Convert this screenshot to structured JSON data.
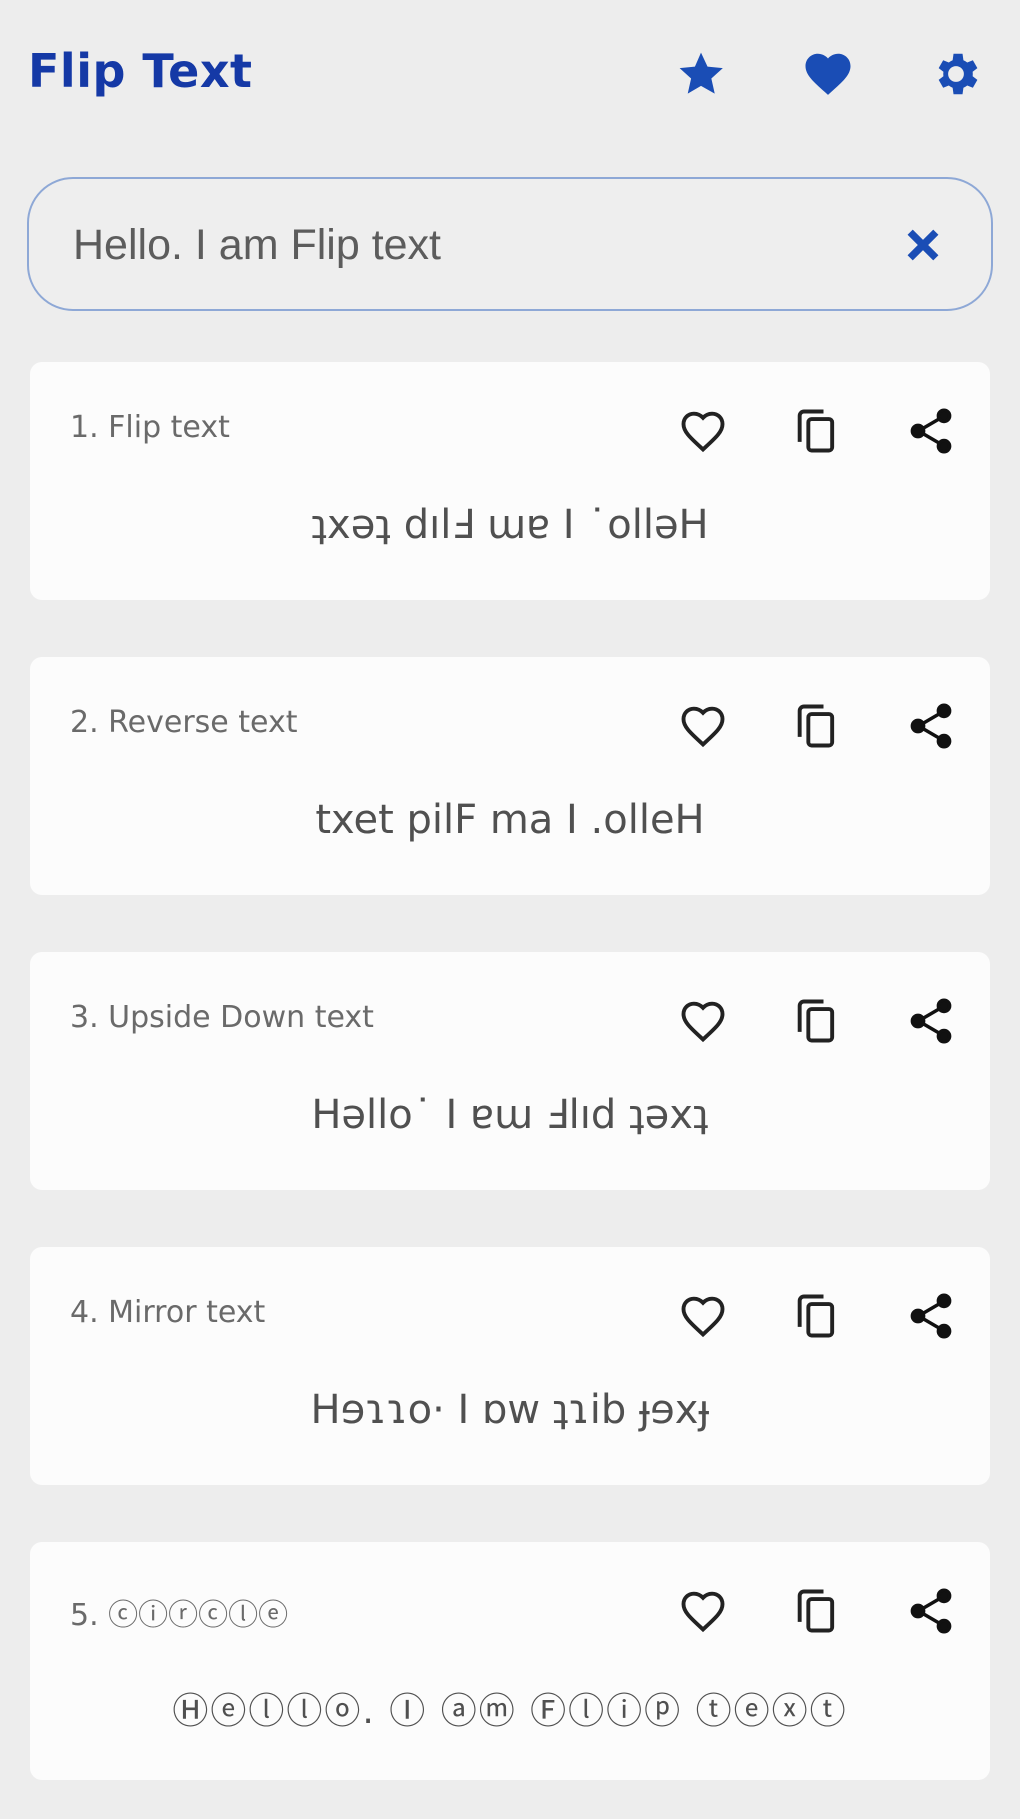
{
  "app": {
    "title": "Flip Text",
    "header_icons": [
      "star-icon",
      "heart-icon",
      "gear-icon"
    ],
    "accent_color": "#1a4db5"
  },
  "search": {
    "value": "Hello. I am Flip text",
    "placeholder": "",
    "clear_icon": "close-icon"
  },
  "results": [
    {
      "label": "1. Flip text",
      "output": "ʇxǝʇ dılℲ ɯɐ I ˙ollǝH",
      "style": "normal"
    },
    {
      "label": "2. Reverse text",
      "output": "txet pilF ma I .olleH",
      "style": "normal"
    },
    {
      "label": "3. Upside Down text",
      "output": "Hǝllo˙ I ɐɯ Ⅎlıd ʇǝxʇ",
      "style": "normal"
    },
    {
      "label": "4. Mirror text",
      "output": "Hɘɿɿo· I ɒw ʇɿib ɟɘxɟ",
      "style": "normal"
    },
    {
      "label": "5. ⓒⓘⓡⓒⓛⓔ",
      "output": "Ⓗⓔⓛⓛⓞ. Ⓘ ⓐⓜ Ⓕⓛⓘⓟ ⓣⓔⓧⓣ",
      "style": "circle"
    }
  ],
  "card_actions": [
    "heart-outline-icon",
    "copy-icon",
    "share-icon"
  ]
}
